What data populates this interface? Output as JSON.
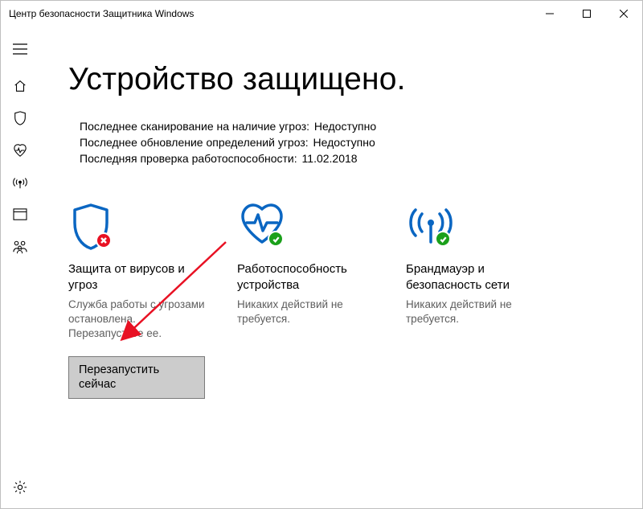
{
  "window": {
    "title": "Центр безопасности Защитника Windows"
  },
  "page": {
    "heading": "Устройство защищено."
  },
  "status": {
    "line1_label": "Последнее сканирование на наличие угроз:",
    "line1_value": "Недоступно",
    "line2_label": "Последнее обновление определений угроз:",
    "line2_value": "Недоступно",
    "line3_label": "Последняя проверка работоспособности:",
    "line3_value": "11.02.2018"
  },
  "cards": {
    "virus": {
      "title": "Защита от вирусов и угроз",
      "desc": "Служба работы с угрозами остановлена. Перезапустите ее.",
      "action": "Перезапустить сейчас",
      "status": "error"
    },
    "health": {
      "title": "Работоспособность устройства",
      "desc": "Никаких действий не требуется.",
      "status": "ok"
    },
    "firewall": {
      "title": "Брандмауэр и безопасность сети",
      "desc": "Никаких действий не требуется.",
      "status": "ok"
    }
  },
  "colors": {
    "accent": "#0A66C2",
    "error": "#E81123",
    "ok": "#1BA01B"
  }
}
